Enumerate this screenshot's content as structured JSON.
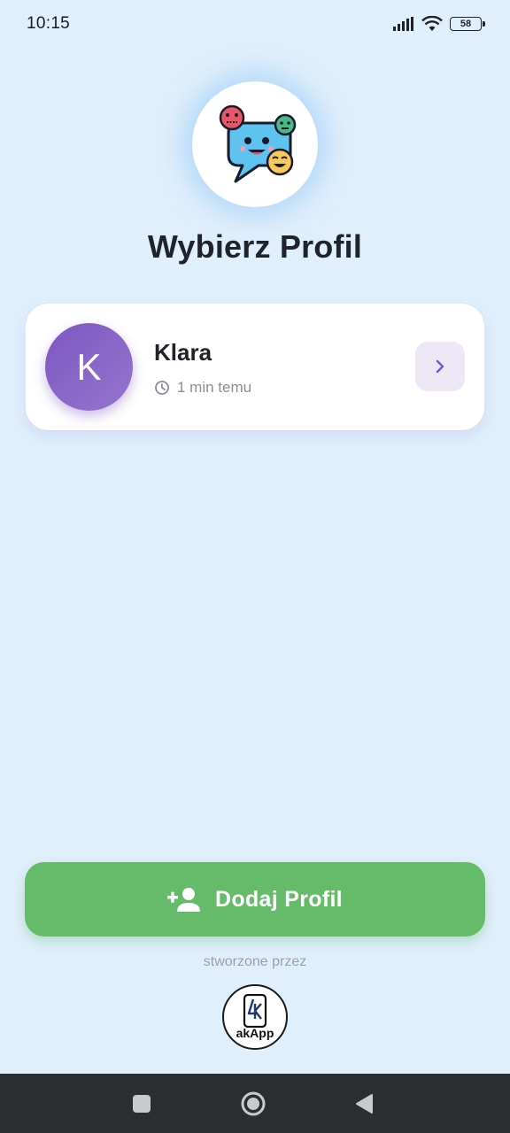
{
  "status_bar": {
    "time": "10:15",
    "battery_level": "58",
    "icons": [
      "signal-icon",
      "wifi-icon",
      "battery-icon"
    ]
  },
  "header": {
    "logo": "chat-emotions-logo",
    "title": "Wybierz Profil"
  },
  "profiles": [
    {
      "initial": "K",
      "name": "Klara",
      "last_active": "1 min temu",
      "avatar_color": "#7e57c2"
    }
  ],
  "actions": {
    "add_profile_label": "Dodaj Profil",
    "add_profile_color": "#66bb6a"
  },
  "footer": {
    "credit": "stworzone przez",
    "brand": "akApp"
  },
  "nav": {
    "buttons": [
      "recents-icon",
      "home-icon",
      "back-icon"
    ]
  },
  "colors": {
    "background": "#e0effc",
    "accent": "#7e57c2"
  }
}
